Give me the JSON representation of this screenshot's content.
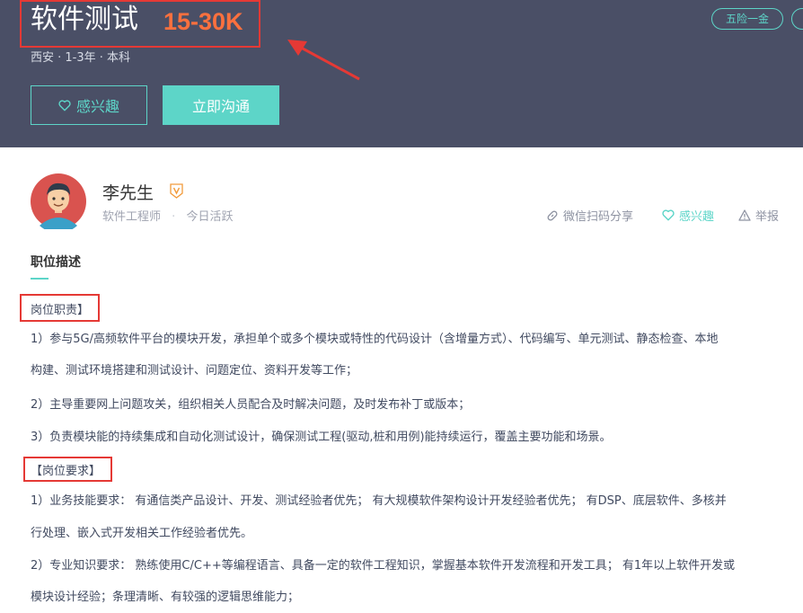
{
  "job": {
    "title": "软件测试",
    "salary": "15-30K",
    "meta": "西安 · 1-3年 · 本科",
    "tag": "五险一金",
    "interest_label": "感兴趣",
    "chat_label": "立即沟通"
  },
  "recruiter": {
    "name": "李先生",
    "position": "软件工程师",
    "separator": "·",
    "activity": "今日活跃",
    "share_label": "微信扫码分享",
    "interest_label": "感兴趣",
    "report_label": "举报"
  },
  "description": {
    "title": "职位描述",
    "duties_label": "岗位职责】",
    "duties": [
      "1）参与5G/高频软件平台的模块开发，承担单个或多个模块或特性的代码设计（含增量方式）、代码编写、单元测试、静态检查、本地",
      "构建、测试环境搭建和测试设计、问题定位、资料开发等工作；",
      "2）主导重要网上问题攻关，组织相关人员配合及时解决问题，及时发布补丁或版本；",
      "3）负责模块能的持续集成和自动化测试设计，确保测试工程(驱动,桩和用例)能持续运行，覆盖主要功能和场景。"
    ],
    "requirements_label": "【岗位要求】",
    "requirements": [
      "1）业务技能要求： 有通信类产品设计、开发、测试经验者优先； 有大规模软件架构设计开发经验者优先； 有DSP、底层软件、多核并",
      "行处理、嵌入式开发相关工作经验者优先。",
      "2）专业知识要求： 熟练使用C/C++等编程语言、具备一定的软件工程知识，掌握基本软件开发流程和开发工具； 有1年以上软件开发或",
      "模块设计经验；条理清晰、有较强的逻辑思维能力；"
    ]
  },
  "colors": {
    "header_bg": "#4a4f66",
    "accent": "#5dd5c8",
    "salary": "#fc703e",
    "annotation": "#e53935"
  }
}
